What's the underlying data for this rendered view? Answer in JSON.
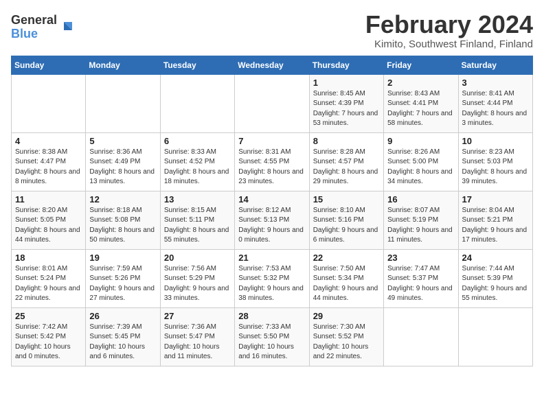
{
  "header": {
    "logo_general": "General",
    "logo_blue": "Blue",
    "title": "February 2024",
    "subtitle": "Kimito, Southwest Finland, Finland"
  },
  "calendar": {
    "days_of_week": [
      "Sunday",
      "Monday",
      "Tuesday",
      "Wednesday",
      "Thursday",
      "Friday",
      "Saturday"
    ],
    "weeks": [
      [
        {
          "day": "",
          "info": ""
        },
        {
          "day": "",
          "info": ""
        },
        {
          "day": "",
          "info": ""
        },
        {
          "day": "",
          "info": ""
        },
        {
          "day": "1",
          "info": "Sunrise: 8:45 AM\nSunset: 4:39 PM\nDaylight: 7 hours and 53 minutes."
        },
        {
          "day": "2",
          "info": "Sunrise: 8:43 AM\nSunset: 4:41 PM\nDaylight: 7 hours and 58 minutes."
        },
        {
          "day": "3",
          "info": "Sunrise: 8:41 AM\nSunset: 4:44 PM\nDaylight: 8 hours and 3 minutes."
        }
      ],
      [
        {
          "day": "4",
          "info": "Sunrise: 8:38 AM\nSunset: 4:47 PM\nDaylight: 8 hours and 8 minutes."
        },
        {
          "day": "5",
          "info": "Sunrise: 8:36 AM\nSunset: 4:49 PM\nDaylight: 8 hours and 13 minutes."
        },
        {
          "day": "6",
          "info": "Sunrise: 8:33 AM\nSunset: 4:52 PM\nDaylight: 8 hours and 18 minutes."
        },
        {
          "day": "7",
          "info": "Sunrise: 8:31 AM\nSunset: 4:55 PM\nDaylight: 8 hours and 23 minutes."
        },
        {
          "day": "8",
          "info": "Sunrise: 8:28 AM\nSunset: 4:57 PM\nDaylight: 8 hours and 29 minutes."
        },
        {
          "day": "9",
          "info": "Sunrise: 8:26 AM\nSunset: 5:00 PM\nDaylight: 8 hours and 34 minutes."
        },
        {
          "day": "10",
          "info": "Sunrise: 8:23 AM\nSunset: 5:03 PM\nDaylight: 8 hours and 39 minutes."
        }
      ],
      [
        {
          "day": "11",
          "info": "Sunrise: 8:20 AM\nSunset: 5:05 PM\nDaylight: 8 hours and 44 minutes."
        },
        {
          "day": "12",
          "info": "Sunrise: 8:18 AM\nSunset: 5:08 PM\nDaylight: 8 hours and 50 minutes."
        },
        {
          "day": "13",
          "info": "Sunrise: 8:15 AM\nSunset: 5:11 PM\nDaylight: 8 hours and 55 minutes."
        },
        {
          "day": "14",
          "info": "Sunrise: 8:12 AM\nSunset: 5:13 PM\nDaylight: 9 hours and 0 minutes."
        },
        {
          "day": "15",
          "info": "Sunrise: 8:10 AM\nSunset: 5:16 PM\nDaylight: 9 hours and 6 minutes."
        },
        {
          "day": "16",
          "info": "Sunrise: 8:07 AM\nSunset: 5:19 PM\nDaylight: 9 hours and 11 minutes."
        },
        {
          "day": "17",
          "info": "Sunrise: 8:04 AM\nSunset: 5:21 PM\nDaylight: 9 hours and 17 minutes."
        }
      ],
      [
        {
          "day": "18",
          "info": "Sunrise: 8:01 AM\nSunset: 5:24 PM\nDaylight: 9 hours and 22 minutes."
        },
        {
          "day": "19",
          "info": "Sunrise: 7:59 AM\nSunset: 5:26 PM\nDaylight: 9 hours and 27 minutes."
        },
        {
          "day": "20",
          "info": "Sunrise: 7:56 AM\nSunset: 5:29 PM\nDaylight: 9 hours and 33 minutes."
        },
        {
          "day": "21",
          "info": "Sunrise: 7:53 AM\nSunset: 5:32 PM\nDaylight: 9 hours and 38 minutes."
        },
        {
          "day": "22",
          "info": "Sunrise: 7:50 AM\nSunset: 5:34 PM\nDaylight: 9 hours and 44 minutes."
        },
        {
          "day": "23",
          "info": "Sunrise: 7:47 AM\nSunset: 5:37 PM\nDaylight: 9 hours and 49 minutes."
        },
        {
          "day": "24",
          "info": "Sunrise: 7:44 AM\nSunset: 5:39 PM\nDaylight: 9 hours and 55 minutes."
        }
      ],
      [
        {
          "day": "25",
          "info": "Sunrise: 7:42 AM\nSunset: 5:42 PM\nDaylight: 10 hours and 0 minutes."
        },
        {
          "day": "26",
          "info": "Sunrise: 7:39 AM\nSunset: 5:45 PM\nDaylight: 10 hours and 6 minutes."
        },
        {
          "day": "27",
          "info": "Sunrise: 7:36 AM\nSunset: 5:47 PM\nDaylight: 10 hours and 11 minutes."
        },
        {
          "day": "28",
          "info": "Sunrise: 7:33 AM\nSunset: 5:50 PM\nDaylight: 10 hours and 16 minutes."
        },
        {
          "day": "29",
          "info": "Sunrise: 7:30 AM\nSunset: 5:52 PM\nDaylight: 10 hours and 22 minutes."
        },
        {
          "day": "",
          "info": ""
        },
        {
          "day": "",
          "info": ""
        }
      ]
    ]
  }
}
